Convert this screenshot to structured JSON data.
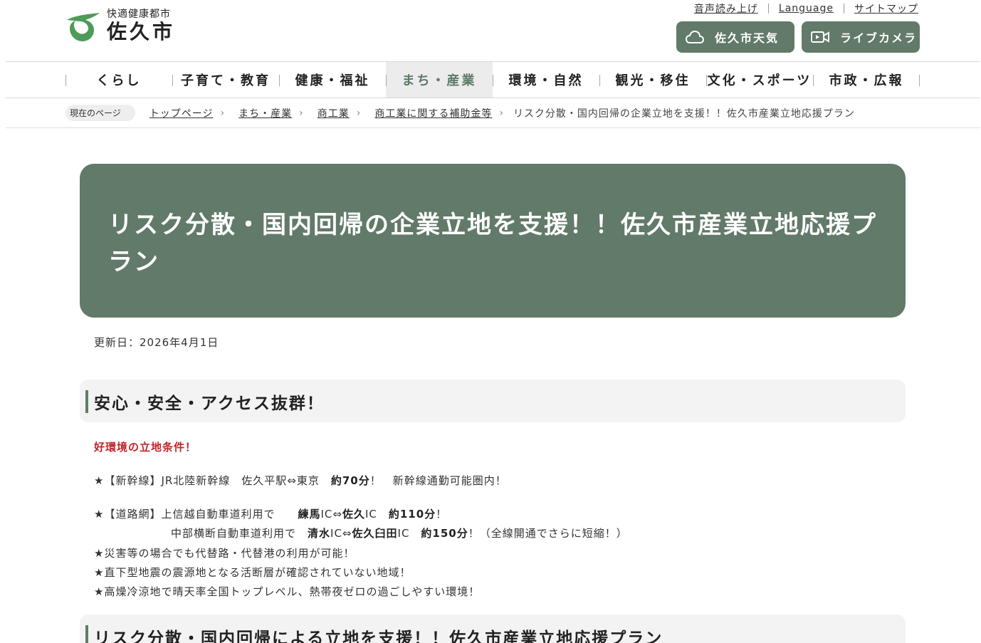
{
  "header": {
    "logo_sub": "快適健康都市",
    "logo_main": "佐久市",
    "util_links": [
      "音声読み上げ",
      "Language",
      "サイトマップ"
    ],
    "weather_button": "佐久市天気",
    "camera_button": "ライブカメラ"
  },
  "nav": {
    "items": [
      "くらし",
      "子育て・教育",
      "健康・福祉",
      "まち・産業",
      "環境・自然",
      "観光・移住",
      "文化・スポーツ",
      "市政・広報"
    ],
    "active": "まち・産業"
  },
  "breadcrumb": {
    "label": "現在のページ",
    "links": [
      "トップページ",
      "まち・産業",
      "商工業",
      "商工業に関する補助金等"
    ],
    "current": "リスク分散・国内回帰の企業立地を支援！！佐久市産業立地応援プラン"
  },
  "page": {
    "title": "リスク分散・国内回帰の企業立地を支援！！佐久市産業立地応援プラン",
    "updated": "更新日：2026年4月1日"
  },
  "section1": {
    "heading": "安心・安全・アクセス抜群！",
    "subtitle": "好環境の立地条件！",
    "shinkansen": {
      "prefix": "★【新幹線】JR北陸新幹線　佐久平駅⇔東京　",
      "bold": "約70分",
      "suffix": "！　新幹線通勤可能圏内！"
    },
    "road1": {
      "prefix": "★【道路網】上信越自動車道利用で　　",
      "bold1": "練馬",
      "mid1": "IC⇔",
      "bold2": "佐久",
      "mid2": "IC　",
      "bold3": "約110分",
      "suffix": "！"
    },
    "road2": {
      "prefix": "中部横断自動車道利用で　",
      "bold1": "清水",
      "mid1": "IC⇔",
      "bold2": "佐久臼田",
      "mid2": "IC　",
      "bold3": "約150分",
      "suffix": "！（全線開通でさらに短縮！）"
    },
    "points": [
      "★災害等の場合でも代替路・代替港の利用が可能！",
      "★直下型地震の震源地となる活断層が確認されていない地域！",
      "★高燥冷涼地で晴天率全国トップレベル、熱帯夜ゼロの過ごしやすい環境！"
    ]
  },
  "section2": {
    "heading": "リスク分散・国内回帰による立地を支援！！佐久市産業立地応援プラン"
  },
  "colors": {
    "accent": "#627a69",
    "highlight": "#c0252a",
    "logo_green": "#4e9a58"
  }
}
